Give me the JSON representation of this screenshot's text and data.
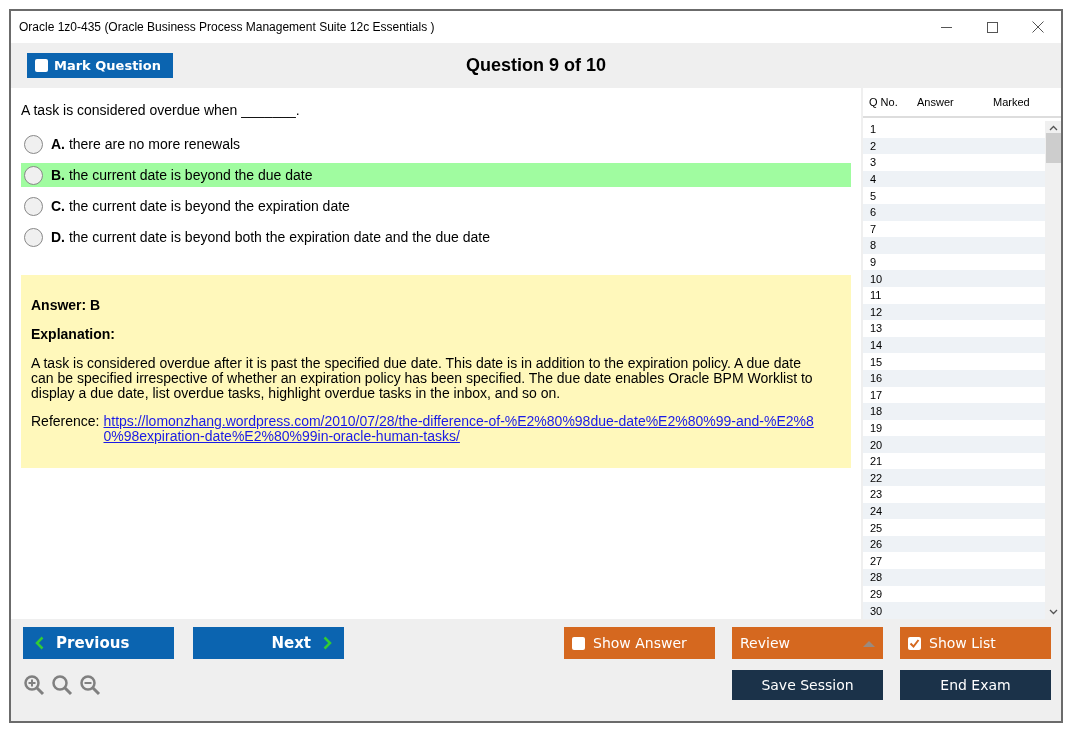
{
  "window": {
    "title": "Oracle 1z0-435 (Oracle Business Process Management Suite 12c Essentials )"
  },
  "toolbar": {
    "mark_question": {
      "label": "Mark Question",
      "checked": false
    },
    "heading": "Question 9 of 10"
  },
  "question": {
    "text": "A task is considered overdue when _______.",
    "options": [
      {
        "letter": "A.",
        "text": "there are no more renewals",
        "selected": false,
        "highlighted": false
      },
      {
        "letter": "B.",
        "text": "the current date is beyond the due date",
        "selected": false,
        "highlighted": true
      },
      {
        "letter": "C.",
        "text": "the current date is beyond the expiration date",
        "selected": false,
        "highlighted": false
      },
      {
        "letter": "D.",
        "text": "the current date is beyond both the expiration date and the due date",
        "selected": false,
        "highlighted": false
      }
    ]
  },
  "answer_panel": {
    "answer": "Answer: B",
    "explanation_label": "Explanation:",
    "explanation": "A task is considered overdue after it is past the specified due date. This date is in addition to the expiration policy. A due date can be specified irrespective of whether an expiration policy has been specified. The due date enables Oracle BPM Worklist to display a due date, list overdue tasks, highlight overdue tasks in the inbox, and so on.",
    "reference_label": "Reference:",
    "reference_link": "https://lomonzhang.wordpress.com/2010/07/28/the-difference-of-%E2%80%98due-date%E2%80%99-and-%E2%80%98expiration-date%E2%80%99in-oracle-human-tasks/"
  },
  "question_list": {
    "columns": [
      "Q No.",
      "Answer",
      "Marked"
    ],
    "rows": [
      {
        "number": "1"
      },
      {
        "number": "2"
      },
      {
        "number": "3"
      },
      {
        "number": "4"
      },
      {
        "number": "5"
      },
      {
        "number": "6"
      },
      {
        "number": "7"
      },
      {
        "number": "8"
      },
      {
        "number": "9"
      },
      {
        "number": "10"
      },
      {
        "number": "11"
      },
      {
        "number": "12"
      },
      {
        "number": "13"
      },
      {
        "number": "14"
      },
      {
        "number": "15"
      },
      {
        "number": "16"
      },
      {
        "number": "17"
      },
      {
        "number": "18"
      },
      {
        "number": "19"
      },
      {
        "number": "20"
      },
      {
        "number": "21"
      },
      {
        "number": "22"
      },
      {
        "number": "23"
      },
      {
        "number": "24"
      },
      {
        "number": "25"
      },
      {
        "number": "26"
      },
      {
        "number": "27"
      },
      {
        "number": "28"
      },
      {
        "number": "29"
      },
      {
        "number": "30"
      }
    ]
  },
  "footer": {
    "previous": "Previous",
    "next": "Next",
    "show_answer": {
      "label": "Show Answer",
      "checked": false
    },
    "review": {
      "label": "Review"
    },
    "show_list": {
      "label": "Show List",
      "checked": true
    },
    "save_session": "Save Session",
    "end_exam": "End Exam"
  }
}
